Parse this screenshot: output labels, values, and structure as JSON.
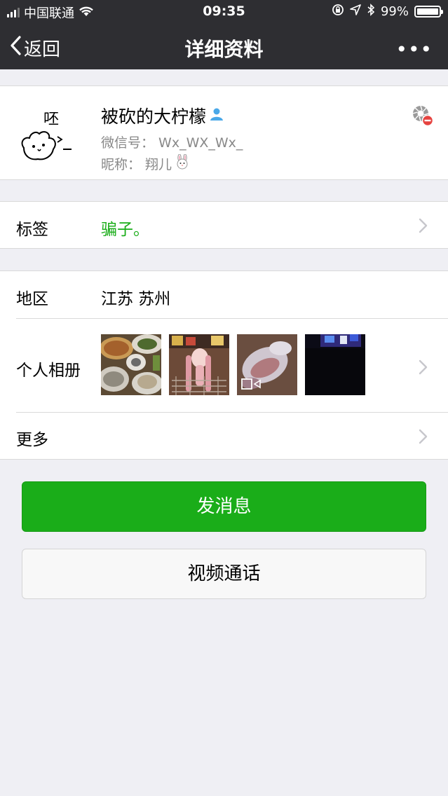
{
  "status_bar": {
    "carrier": "中国联通",
    "time": "09:35",
    "battery_percent": "99%",
    "battery_level": 0.99
  },
  "nav": {
    "back_label": "返回",
    "title": "详细资料",
    "more_label": "•••"
  },
  "profile": {
    "name": "被砍的大柠檬",
    "wechat_id": "微信号：  Wx_WX_Wx_",
    "nickname": "昵称：  翔儿",
    "avatar_text": "呸"
  },
  "tags": {
    "label": "标签",
    "value": "骗子。",
    "value_color": "#1AAD19"
  },
  "info": {
    "region_label": "地区",
    "region_value": "江苏 苏州",
    "album_label": "个人相册",
    "more_label": "更多"
  },
  "buttons": {
    "message_label": "发消息",
    "video_call_label": "视频通话"
  },
  "colors": {
    "accent": "#1AAD19",
    "nav_bg": "#2E2E32",
    "page_bg": "#EFEFF4"
  }
}
